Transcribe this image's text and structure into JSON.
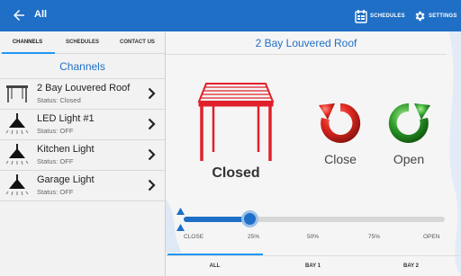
{
  "appbar": {
    "title": "All",
    "schedules_label": "SCHEDULES",
    "settings_label": "SETTINGS"
  },
  "left_tabs": [
    {
      "label": "CHANNELS",
      "active": true
    },
    {
      "label": "SCHEDULES",
      "active": false
    },
    {
      "label": "CONTACT US",
      "active": false
    }
  ],
  "channels": {
    "heading": "Channels",
    "items": [
      {
        "name": "2 Bay Louvered Roof",
        "status": "Status: Closed",
        "icon": "roof-icon"
      },
      {
        "name": "LED Light #1",
        "status": "Status: OFF",
        "icon": "lamp-icon"
      },
      {
        "name": "Kitchen Light",
        "status": "Status: OFF",
        "icon": "lamp-icon"
      },
      {
        "name": "Garage Light",
        "status": "Status: OFF",
        "icon": "lamp-icon"
      }
    ]
  },
  "detail": {
    "title": "2 Bay Louvered Roof",
    "state": "Closed",
    "close_label": "Close",
    "open_label": "Open",
    "slider": {
      "position_fraction": 0.25,
      "ticks": [
        "CLOSE",
        "25%",
        "50%",
        "75%",
        "OPEN"
      ]
    },
    "bay_tabs": [
      {
        "label": "ALL",
        "active": true
      },
      {
        "label": "BAY 1",
        "active": false
      },
      {
        "label": "BAY 2",
        "active": false
      }
    ]
  },
  "colors": {
    "primary": "#1f6fc6",
    "accent": "#2196f3",
    "roof_red": "#e0202a",
    "close_red": "#d7261f",
    "open_green": "#2e9b2a"
  }
}
